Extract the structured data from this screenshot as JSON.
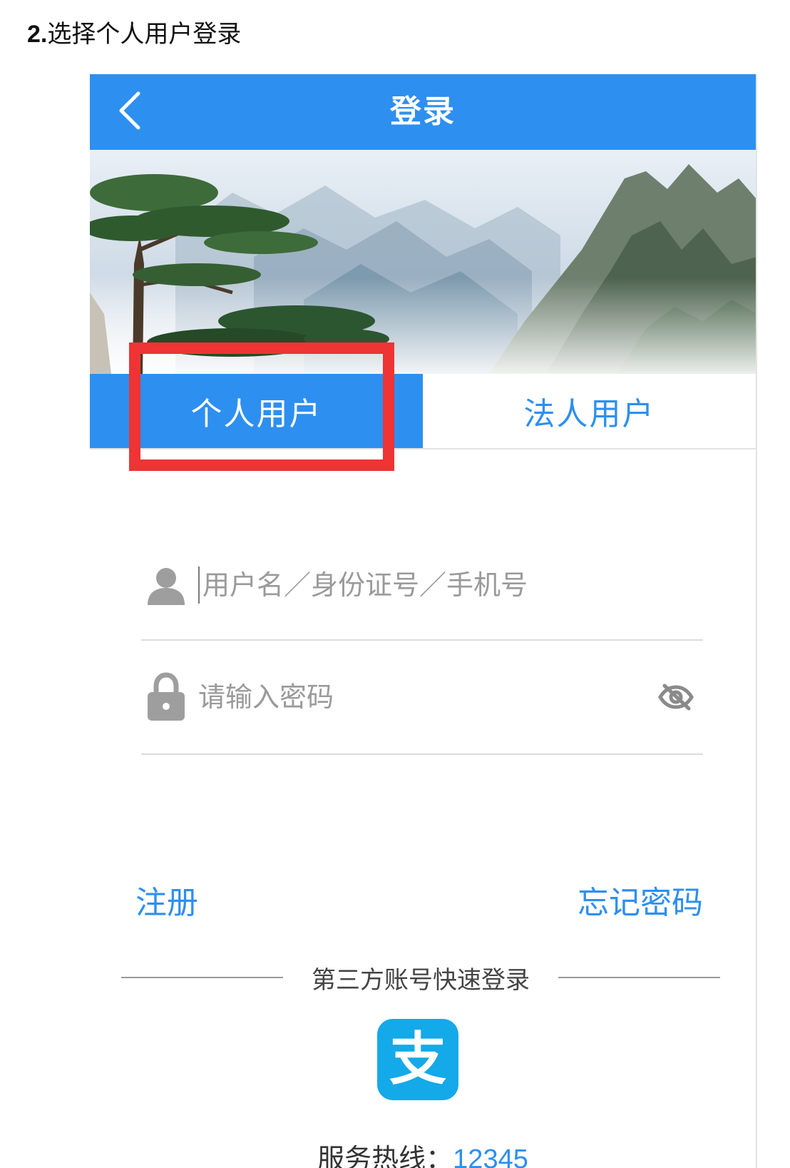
{
  "document": {
    "step_number": "2.",
    "step_text": "选择个人用户登录"
  },
  "app": {
    "title": "登录",
    "back_icon": "chevron-left-icon",
    "accent_color": "#2d8ff0"
  },
  "tabs": [
    {
      "label": "个人用户",
      "active": true
    },
    {
      "label": "法人用户",
      "active": false
    }
  ],
  "annotation": {
    "highlight_color": "#ee3434",
    "target": "个人用户"
  },
  "form": {
    "username": {
      "placeholder": "用户名／身份证号／手机号",
      "value": "",
      "icon": "user-icon"
    },
    "password": {
      "placeholder": "请输入密码",
      "value": "",
      "icon": "lock-icon",
      "toggle_icon": "eye-off-icon"
    }
  },
  "links": {
    "register": "注册",
    "forgot_password": "忘记密码"
  },
  "third_party": {
    "label": "第三方账号快速登录",
    "alipay_glyph": "支",
    "alipay_color": "#14a9e8"
  },
  "hotline": {
    "label": "服务热线：",
    "number": "12345"
  }
}
